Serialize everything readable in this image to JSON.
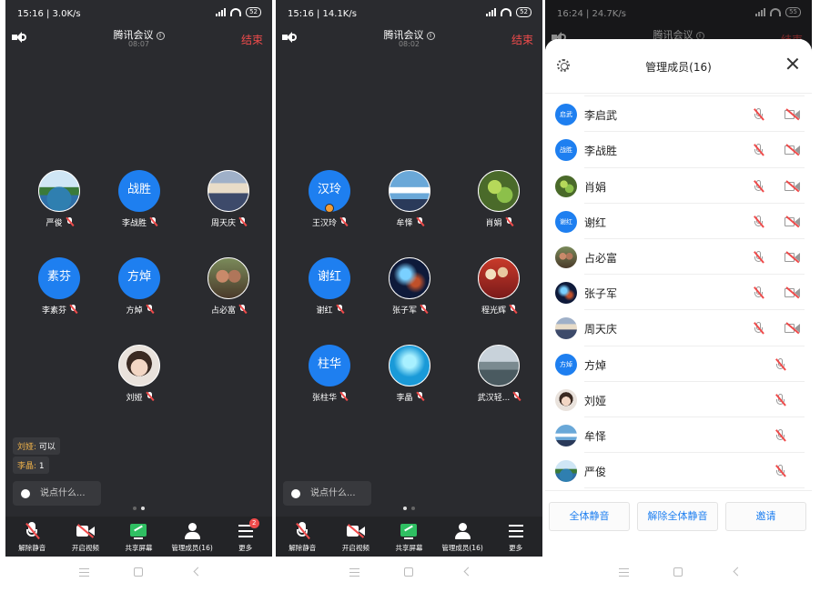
{
  "colors": {
    "accent": "#1e7ff0",
    "danger": "#ef4b4b",
    "bg": "#2a2b2f"
  },
  "screens": [
    {
      "status": {
        "time": "15:16 | 3.0K/s",
        "battery": "52"
      },
      "title": "腾讯会议",
      "duration": "08:07",
      "end": "结束",
      "participants": [
        {
          "name": "严俊",
          "avatar_text": "",
          "photo": "seashore"
        },
        {
          "name": "李战胜",
          "avatar_text": "战胜"
        },
        {
          "name": "周天庆",
          "avatar_text": "",
          "photo": "person"
        },
        {
          "name": "李素芬",
          "avatar_text": "素芬"
        },
        {
          "name": "方焯",
          "avatar_text": "方焯"
        },
        {
          "name": "占必富",
          "avatar_text": "",
          "photo": "group"
        },
        {
          "name": "刘娅",
          "avatar_text": "",
          "photo": "portrait"
        }
      ],
      "chat": [
        {
          "who": "刘娅:",
          "text": "可以"
        },
        {
          "who": "李晶:",
          "text": "1"
        }
      ],
      "chat_placeholder": "说点什么...",
      "toolbar": [
        "解除静音",
        "开启视频",
        "共享屏幕",
        "管理成员(16)",
        "更多"
      ],
      "more_badge": "2"
    },
    {
      "status": {
        "time": "15:16 | 14.1K/s",
        "battery": "52"
      },
      "title": "腾讯会议",
      "duration": "08:02",
      "end": "结束",
      "participants": [
        {
          "name": "王汉玲",
          "avatar_text": "汉玲",
          "host": true
        },
        {
          "name": "牟怿",
          "avatar_text": "",
          "photo": "football"
        },
        {
          "name": "肖娟",
          "avatar_text": "",
          "photo": "plant"
        },
        {
          "name": "谢红",
          "avatar_text": "谢红"
        },
        {
          "name": "张子军",
          "avatar_text": "",
          "photo": "nebula"
        },
        {
          "name": "程光辉",
          "avatar_text": "",
          "photo": "crowd"
        },
        {
          "name": "张柱华",
          "avatar_text": "柱华"
        },
        {
          "name": "李晶",
          "avatar_text": "",
          "photo": "water"
        },
        {
          "name": "武汉轻...",
          "avatar_text": "",
          "photo": "mist"
        }
      ],
      "chat_placeholder": "说点什么...",
      "toolbar": [
        "解除静音",
        "开启视频",
        "共享屏幕",
        "管理成员(16)",
        "更多"
      ]
    },
    {
      "status": {
        "time": "16:24 | 24.7K/s",
        "battery": "55"
      },
      "title": "腾讯会议",
      "end": "结束",
      "sheet_title": "管理成员(16)",
      "members": [
        {
          "name": "李启武",
          "avatar_text": "启武",
          "cam": true
        },
        {
          "name": "李战胜",
          "avatar_text": "战胜",
          "cam": true
        },
        {
          "name": "肖娟",
          "avatar_text": "",
          "photo": "plant",
          "cam": true
        },
        {
          "name": "谢红",
          "avatar_text": "谢红",
          "cam": true
        },
        {
          "name": "占必富",
          "avatar_text": "",
          "photo": "group",
          "cam": true
        },
        {
          "name": "张子军",
          "avatar_text": "",
          "photo": "nebula",
          "cam": true
        },
        {
          "name": "周天庆",
          "avatar_text": "",
          "photo": "person",
          "cam": true
        },
        {
          "name": "方焯",
          "avatar_text": "方焯",
          "cam": false
        },
        {
          "name": "刘娅",
          "avatar_text": "",
          "photo": "portrait",
          "cam": false
        },
        {
          "name": "牟怿",
          "avatar_text": "",
          "photo": "football",
          "cam": false
        },
        {
          "name": "严俊",
          "avatar_text": "",
          "photo": "seashore",
          "cam": false
        }
      ],
      "footer": [
        "全体静音",
        "解除全体静音",
        "邀请"
      ]
    }
  ]
}
